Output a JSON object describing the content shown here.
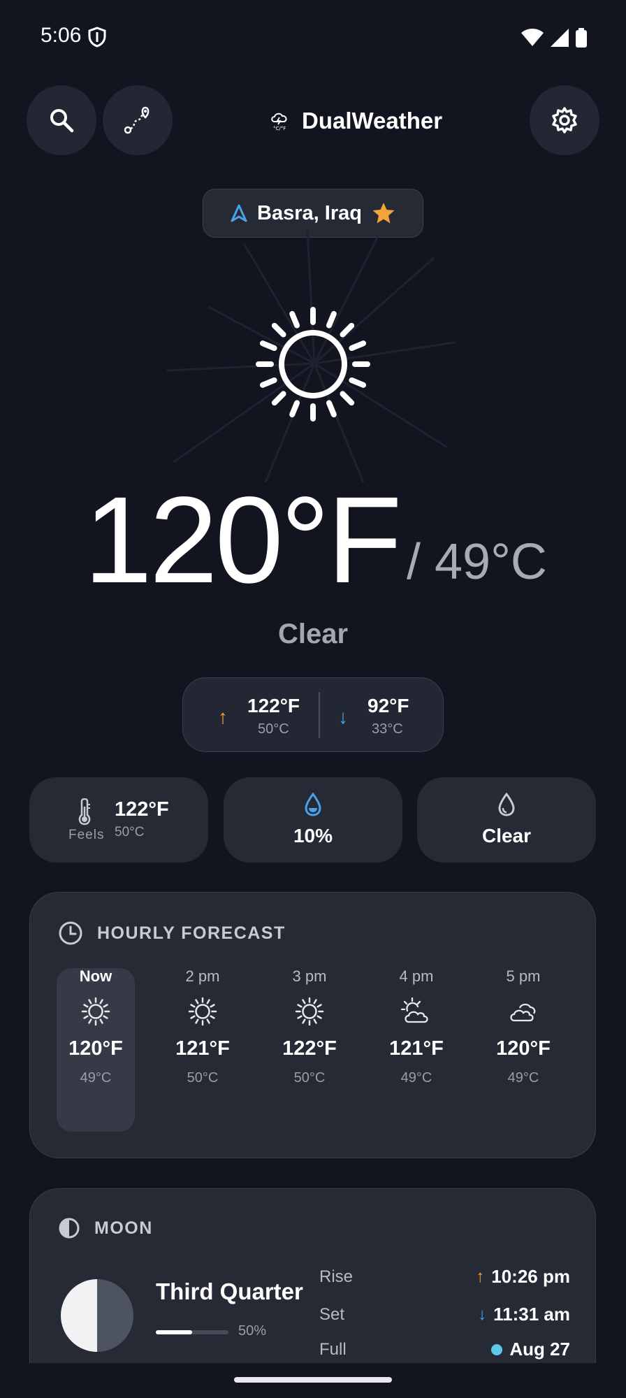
{
  "status_bar": {
    "time": "5:06"
  },
  "header": {
    "app_name": "DualWeather"
  },
  "location": {
    "name": "Basra, Iraq"
  },
  "current": {
    "temp_f": "120°F",
    "temp_c": "/ 49°C",
    "condition": "Clear",
    "high": {
      "f": "122°F",
      "c": "50°C"
    },
    "low": {
      "f": "92°F",
      "c": "33°C"
    }
  },
  "tiles": {
    "feels": {
      "label": "Feels",
      "f": "122°F",
      "c": "50°C"
    },
    "precip": {
      "value": "10%"
    },
    "sky": {
      "value": "Clear"
    }
  },
  "hourly": {
    "title": "HOURLY FORECAST",
    "items": [
      {
        "time": "Now",
        "icon": "sun-icon",
        "f": "120°F",
        "c": "49°C"
      },
      {
        "time": "2 pm",
        "icon": "sun-icon",
        "f": "121°F",
        "c": "50°C"
      },
      {
        "time": "3 pm",
        "icon": "sun-icon",
        "f": "122°F",
        "c": "50°C"
      },
      {
        "time": "4 pm",
        "icon": "partly-cloudy-icon",
        "f": "121°F",
        "c": "49°C"
      },
      {
        "time": "5 pm",
        "icon": "cloud-icon",
        "f": "120°F",
        "c": "49°C"
      }
    ]
  },
  "moon": {
    "title": "MOON",
    "phase": "Third Quarter",
    "illumination": "50%",
    "illumination_fraction": 0.5,
    "rise_label": "Rise",
    "rise": "10:26 pm",
    "set_label": "Set",
    "set": "11:31 am",
    "full_label": "Full",
    "full": "Aug 27"
  },
  "colors": {
    "background": "#121520",
    "card": "#262a35",
    "accent_blue": "#4aa3ea",
    "accent_orange": "#f2a33a",
    "moon_dot": "#5ec8ea"
  }
}
